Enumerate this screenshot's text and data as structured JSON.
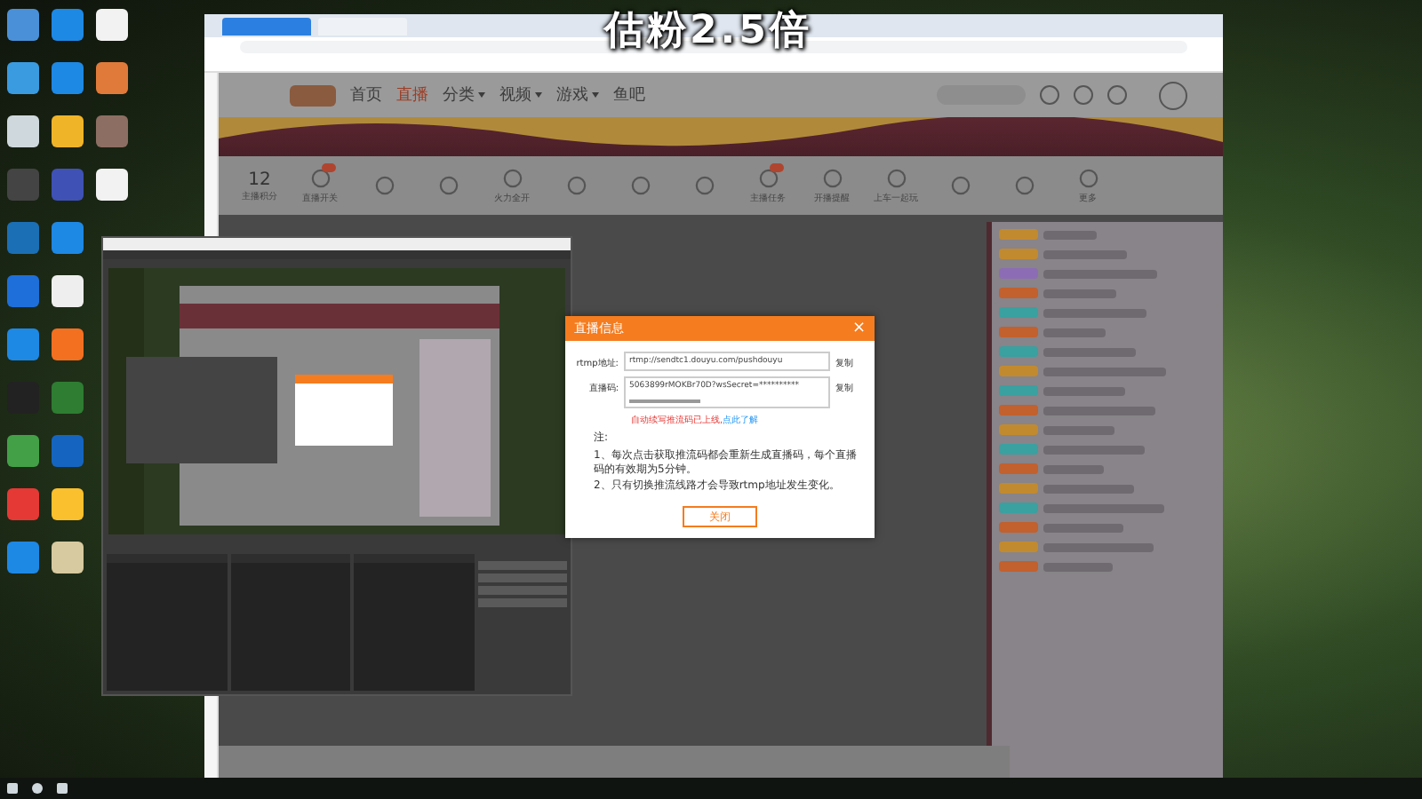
{
  "overlay_caption": "估粉2.5倍",
  "browser": {
    "nav": [
      {
        "label": "首页",
        "selected": false,
        "dropdown": false
      },
      {
        "label": "直播",
        "selected": true,
        "dropdown": false
      },
      {
        "label": "分类",
        "selected": false,
        "dropdown": true
      },
      {
        "label": "视频",
        "selected": false,
        "dropdown": true
      },
      {
        "label": "游戏",
        "selected": false,
        "dropdown": true
      },
      {
        "label": "鱼吧",
        "selected": false,
        "dropdown": false
      }
    ],
    "score": {
      "value": "12",
      "label": "主播积分"
    },
    "tools": [
      {
        "label": "直播开关",
        "badge": true
      },
      {
        "badge": false
      },
      {
        "badge": false
      },
      {
        "label": "火力全开",
        "badge": false
      },
      {
        "badge": false
      },
      {
        "badge": false
      },
      {
        "badge": false
      },
      {
        "label": "主播任务",
        "badge": true
      },
      {
        "label": "开播提醒",
        "badge": false
      },
      {
        "label": "上车一起玩",
        "badge": false
      },
      {
        "badge": false
      },
      {
        "badge": false
      },
      {
        "label": "更多",
        "badge": false
      }
    ]
  },
  "dialog": {
    "title": "直播信息",
    "close": "×",
    "fields": [
      {
        "label": "rtmp地址:",
        "value": "rtmp://sendtc1.douyu.com/pushdouyu",
        "action": "复制"
      },
      {
        "label": "直播码:",
        "value": "5063899rMOKBr70D?wsSecret=**********",
        "action": "复制"
      }
    ],
    "notice": "自动续写推流码已上线,",
    "notice_link": "点此了解",
    "notes_title": "注:",
    "notes": [
      "1、每次点击获取推流码都会重新生成直播码，每个直播码的有效期为5分钟。",
      "2、只有切换推流线路才会导致rtmp地址发生变化。"
    ],
    "button": "关闭"
  }
}
